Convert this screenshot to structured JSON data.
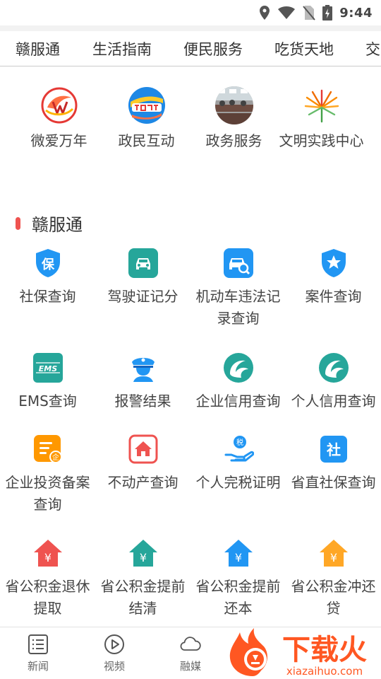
{
  "status": {
    "time": "9:44"
  },
  "tabs": [
    {
      "label": "赣服通"
    },
    {
      "label": "生活指南"
    },
    {
      "label": "便民服务"
    },
    {
      "label": "吃货天地"
    },
    {
      "label": "交"
    }
  ],
  "top_shortcuts": [
    {
      "label": "微爱万年",
      "icon": "weiai-logo-icon"
    },
    {
      "label": "政民互动",
      "icon": "zhengmin-logo-icon"
    },
    {
      "label": "政务服务",
      "icon": "office-photo-icon"
    },
    {
      "label": "文明实践中心",
      "icon": "wenming-logo-icon"
    }
  ],
  "section": {
    "title": "赣服通"
  },
  "services": [
    {
      "label": "社保查询",
      "icon": "shield-bao-icon",
      "color": "#2196f3"
    },
    {
      "label": "驾驶证记分",
      "icon": "car-front-icon",
      "color": "#26a69a"
    },
    {
      "label": "机动车违法记录查询",
      "icon": "car-search-icon",
      "color": "#2196f3"
    },
    {
      "label": "案件查询",
      "icon": "star-shield-icon",
      "color": "#2196f3"
    },
    {
      "label": "EMS查询",
      "icon": "ems-icon",
      "color": "#26a69a"
    },
    {
      "label": "报警结果",
      "icon": "police-icon",
      "color": "#2196f3"
    },
    {
      "label": "企业信用查询",
      "icon": "credit-swirl-icon",
      "color": "#26a69a"
    },
    {
      "label": "个人信用查询",
      "icon": "credit-swirl-icon",
      "color": "#26a69a"
    },
    {
      "label": "企业投资备案查询",
      "icon": "document-qi-icon",
      "color": "#ff9800"
    },
    {
      "label": "不动产查询",
      "icon": "house-icon",
      "color": "#ef5350"
    },
    {
      "label": "个人完税证明",
      "icon": "tax-hand-icon",
      "color": "#2196f3"
    },
    {
      "label": "省直社保查询",
      "icon": "she-badge-icon",
      "color": "#2196f3"
    },
    {
      "label": "省公积金退休提取",
      "icon": "yuan-house-icon",
      "color": "#ef5350"
    },
    {
      "label": "省公积金提前结清",
      "icon": "yuan-house-icon",
      "color": "#26a69a"
    },
    {
      "label": "省公积金提前还本",
      "icon": "yuan-house-icon",
      "color": "#2196f3"
    },
    {
      "label": "省公积金冲还贷",
      "icon": "yuan-house-icon",
      "color": "#ffa726"
    }
  ],
  "bottom_nav": [
    {
      "label": "新闻",
      "icon": "news-list-icon"
    },
    {
      "label": "视频",
      "icon": "play-circle-icon"
    },
    {
      "label": "融媒",
      "icon": "cloud-icon"
    }
  ],
  "watermark": {
    "text": "下载火",
    "sub": "xiazaihuo.com"
  }
}
